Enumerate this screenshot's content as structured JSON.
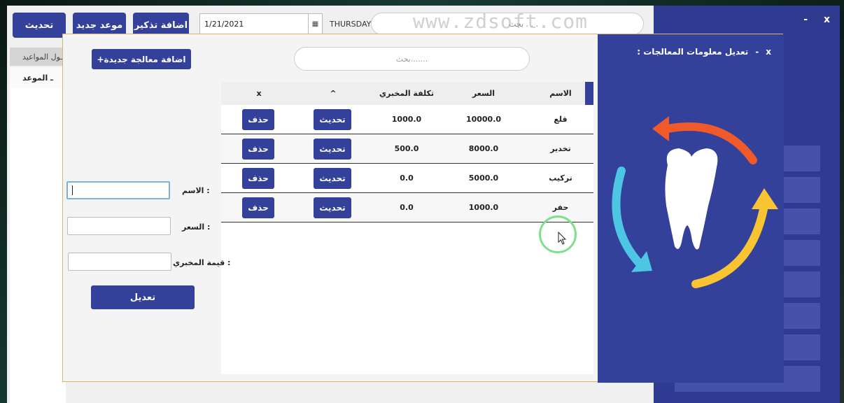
{
  "main": {
    "buttons": {
      "refresh": "تحديث",
      "new_appointment": "موعد جديد",
      "add_reminder": "اضافة تذكير"
    },
    "date_value": "1/21/2021",
    "day": "THURSDAY",
    "search_placeholder": "بحث . . .",
    "watermark": "www.zdsoft.com",
    "appointments_tab": "ـول المواعيد",
    "appointment_column": "ـ الموعد"
  },
  "side": {
    "minimize": "-",
    "close": "x"
  },
  "dialog": {
    "title": "تعديل معلومات المعالجات :",
    "minimize": "-",
    "close": "x",
    "add_button": "+اضافة معالجة جديدة",
    "search_placeholder": "بحث.......",
    "table": {
      "headers": {
        "name": "الاسم",
        "price": "السعر",
        "lab_cost": "تكلفة المخبري",
        "sort": "^",
        "delete": "x"
      },
      "rows": [
        {
          "name": "قلع",
          "price": "10000.0",
          "lab_cost": "1000.0",
          "update": "تحديث",
          "delete": "حذف"
        },
        {
          "name": "تخدير",
          "price": "8000.0",
          "lab_cost": "500.0",
          "update": "تحديث",
          "delete": "حذف"
        },
        {
          "name": "تركيب",
          "price": "5000.0",
          "lab_cost": "0.0",
          "update": "تحديث",
          "delete": "حذف"
        },
        {
          "name": "حفر",
          "price": "1000.0",
          "lab_cost": "0.0",
          "update": "تحديث",
          "delete": "حذف"
        }
      ]
    },
    "form": {
      "name_label": "الاسم :",
      "price_label": "السعر :",
      "lab_label": "قيمة المخبري :",
      "submit": "تعديل"
    }
  },
  "colors": {
    "primary": "#34419b",
    "arrow_red": "#f05a2a",
    "arrow_yellow": "#f8c431",
    "arrow_cyan": "#4cc6e3"
  }
}
